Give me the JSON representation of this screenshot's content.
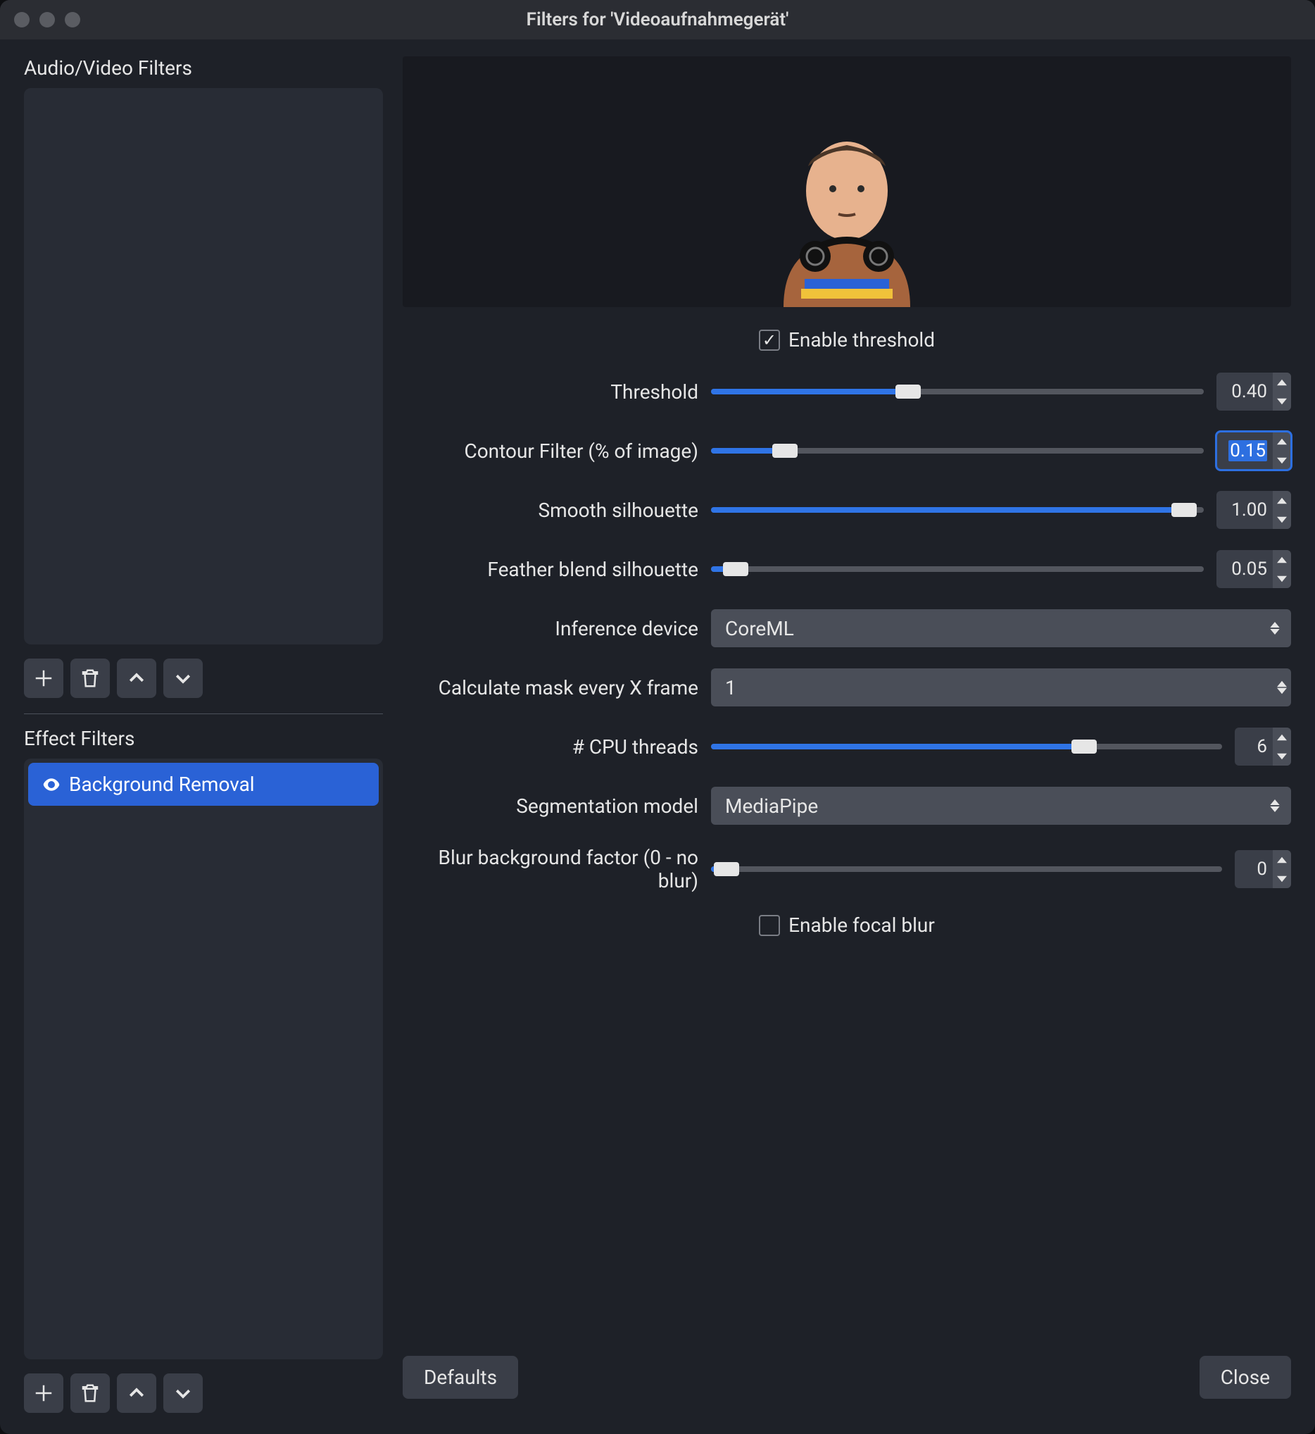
{
  "window": {
    "title": "Filters for 'Videoaufnahmegerät'"
  },
  "sidebar": {
    "av_label": "Audio/Video Filters",
    "fx_label": "Effect Filters",
    "fx_items": [
      {
        "label": "Background Removal",
        "selected": true
      }
    ]
  },
  "settings": {
    "enable_threshold": {
      "label": "Enable threshold",
      "checked": true
    },
    "threshold": {
      "label": "Threshold",
      "value": "0.40",
      "percent": 40
    },
    "contour": {
      "label": "Contour Filter (% of image)",
      "value": "0.15",
      "percent": 15,
      "focused": true
    },
    "smooth": {
      "label": "Smooth silhouette",
      "value": "1.00",
      "percent": 96
    },
    "feather": {
      "label": "Feather blend silhouette",
      "value": "0.05",
      "percent": 5
    },
    "inference_device": {
      "label": "Inference device",
      "value": "CoreML"
    },
    "mask_frame": {
      "label": "Calculate mask every X frame",
      "value": "1"
    },
    "cpu_threads": {
      "label": "# CPU threads",
      "value": "6",
      "percent": 73
    },
    "seg_model": {
      "label": "Segmentation model",
      "value": "MediaPipe"
    },
    "blur_factor": {
      "label": "Blur background factor (0 - no blur)",
      "value": "0",
      "percent": 3
    },
    "enable_focal_blur": {
      "label": "Enable focal blur",
      "checked": false
    }
  },
  "buttons": {
    "defaults": "Defaults",
    "close": "Close"
  }
}
